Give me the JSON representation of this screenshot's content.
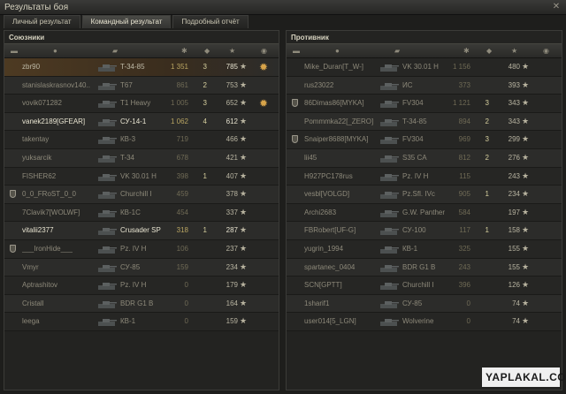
{
  "window": {
    "title": "Результаты боя",
    "close_label": "✕"
  },
  "tabs": [
    {
      "label": "Личный результат",
      "active": false
    },
    {
      "label": "Командный результат",
      "active": true
    },
    {
      "label": "Подробный отчёт",
      "active": false
    }
  ],
  "allies": {
    "title": "Союзники",
    "players": [
      {
        "name": "zbr90",
        "tank": "T-34-85",
        "damage": "1 351",
        "kills": "3",
        "xp": "785",
        "status": "self",
        "squad": false,
        "medal": true
      },
      {
        "name": "stanislaskrasnov140..",
        "tank": "T67",
        "damage": "861",
        "kills": "2",
        "xp": "753",
        "status": "dead",
        "squad": false,
        "medal": false
      },
      {
        "name": "vovik071282",
        "tank": "T1 Heavy",
        "damage": "1 005",
        "kills": "3",
        "xp": "652",
        "status": "dead",
        "squad": false,
        "medal": true
      },
      {
        "name": "vanek2189[GFEAR]",
        "tank": "СУ-14-1",
        "damage": "1 062",
        "kills": "4",
        "xp": "612",
        "status": "alive",
        "squad": false,
        "medal": false
      },
      {
        "name": "takentay",
        "tank": "КВ-3",
        "damage": "719",
        "kills": "",
        "xp": "466",
        "status": "dead",
        "squad": false,
        "medal": false
      },
      {
        "name": "yuksarcik",
        "tank": "T-34",
        "damage": "678",
        "kills": "",
        "xp": "421",
        "status": "dead",
        "squad": false,
        "medal": false
      },
      {
        "name": "FISHER62",
        "tank": "VK 30.01 H",
        "damage": "398",
        "kills": "1",
        "xp": "407",
        "status": "dead",
        "squad": false,
        "medal": false
      },
      {
        "name": "0_0_FRoST_0_0",
        "tank": "Churchill I",
        "damage": "459",
        "kills": "",
        "xp": "378",
        "status": "dead",
        "squad": true,
        "medal": false
      },
      {
        "name": "7Clavik7[WOLWF]",
        "tank": "КВ-1С",
        "damage": "454",
        "kills": "",
        "xp": "337",
        "status": "dead",
        "squad": false,
        "medal": false
      },
      {
        "name": "vitalii2377",
        "tank": "Crusader SP",
        "damage": "318",
        "kills": "1",
        "xp": "287",
        "status": "alive",
        "squad": false,
        "medal": false
      },
      {
        "name": "___IronHide___",
        "tank": "Pz. IV H",
        "damage": "106",
        "kills": "",
        "xp": "237",
        "status": "dead",
        "squad": true,
        "medal": false
      },
      {
        "name": "Vmyr",
        "tank": "СУ-85",
        "damage": "159",
        "kills": "",
        "xp": "234",
        "status": "dead",
        "squad": false,
        "medal": false
      },
      {
        "name": "Aptrashitov",
        "tank": "Pz. IV H",
        "damage": "0",
        "kills": "",
        "xp": "179",
        "status": "dead",
        "squad": false,
        "medal": false
      },
      {
        "name": "Cristall",
        "tank": "BDR G1 B",
        "damage": "0",
        "kills": "",
        "xp": "164",
        "status": "dead",
        "squad": false,
        "medal": false
      },
      {
        "name": "leega",
        "tank": "КВ-1",
        "damage": "0",
        "kills": "",
        "xp": "159",
        "status": "dead",
        "squad": false,
        "medal": false
      }
    ]
  },
  "enemies": {
    "title": "Противник",
    "players": [
      {
        "name": "Mike_Duran[T_W-]",
        "tank": "VK 30.01 H",
        "damage": "1 156",
        "kills": "",
        "xp": "480",
        "status": "dead",
        "squad": false
      },
      {
        "name": "rus23022",
        "tank": "ИС",
        "damage": "373",
        "kills": "",
        "xp": "393",
        "status": "dead",
        "squad": false
      },
      {
        "name": "86Dimas86[MYKA]",
        "tank": "FV304",
        "damage": "1 121",
        "kills": "3",
        "xp": "343",
        "status": "dead",
        "squad": true
      },
      {
        "name": "Pommmka22[_ZERO]",
        "tank": "T-34-85",
        "damage": "894",
        "kills": "2",
        "xp": "343",
        "status": "dead",
        "squad": false
      },
      {
        "name": "Snaiper8688[MYKA]",
        "tank": "FV304",
        "damage": "969",
        "kills": "3",
        "xp": "299",
        "status": "dead",
        "squad": true
      },
      {
        "name": "lii45",
        "tank": "S35 CA",
        "damage": "812",
        "kills": "2",
        "xp": "276",
        "status": "dead",
        "squad": false
      },
      {
        "name": "H927PC178rus",
        "tank": "Pz. IV H",
        "damage": "115",
        "kills": "",
        "xp": "243",
        "status": "dead",
        "squad": false
      },
      {
        "name": "vesbl[VOLGD]",
        "tank": "Pz.Sfl. IVc",
        "damage": "905",
        "kills": "1",
        "xp": "234",
        "status": "dead",
        "squad": false
      },
      {
        "name": "Archi2683",
        "tank": "G.W. Panther",
        "damage": "584",
        "kills": "",
        "xp": "197",
        "status": "dead",
        "squad": false
      },
      {
        "name": "FBRobert[UF-G]",
        "tank": "СУ-100",
        "damage": "117",
        "kills": "1",
        "xp": "158",
        "status": "dead",
        "squad": false
      },
      {
        "name": "yugrin_1994",
        "tank": "КВ-1",
        "damage": "325",
        "kills": "",
        "xp": "155",
        "status": "dead",
        "squad": false
      },
      {
        "name": "spartanec_0404",
        "tank": "BDR G1 B",
        "damage": "243",
        "kills": "",
        "xp": "155",
        "status": "dead",
        "squad": false
      },
      {
        "name": "SCN[GPTT]",
        "tank": "Churchill I",
        "damage": "396",
        "kills": "",
        "xp": "126",
        "status": "dead",
        "squad": false
      },
      {
        "name": "1sharif1",
        "tank": "СУ-85",
        "damage": "0",
        "kills": "",
        "xp": "74",
        "status": "dead",
        "squad": false
      },
      {
        "name": "user014[5_LGN]",
        "tank": "Wolverine",
        "damage": "0",
        "kills": "",
        "xp": "74",
        "status": "dead",
        "squad": false
      }
    ]
  },
  "watermark": {
    "text": "YAPLAKAL.COM"
  },
  "colors": {
    "self_row": "#4d3a22",
    "alive_text": "#e9e5d2",
    "dead_text": "#8d897a",
    "damage": "#b9a562",
    "medal": "#d8a44a"
  }
}
